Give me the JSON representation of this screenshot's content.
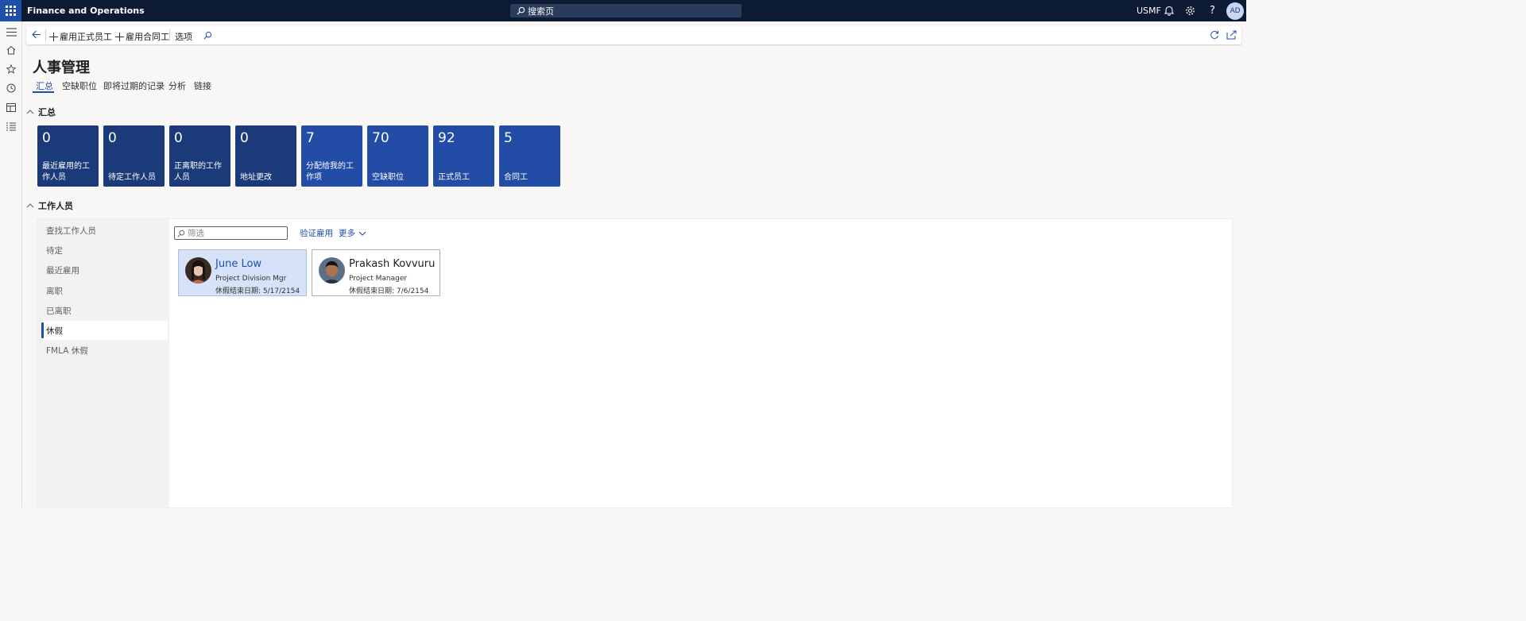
{
  "app": {
    "title": "Finance and Operations",
    "search_placeholder": "搜索页",
    "company": "USMF",
    "user_initials": "AD"
  },
  "action_pane": {
    "hire_employee": "雇用正式员工",
    "hire_contractor": "雇用合同工",
    "options": "选项"
  },
  "page": {
    "title": "人事管理",
    "tabs": [
      {
        "label": "汇总"
      },
      {
        "label": "空缺职位"
      },
      {
        "label": "即将过期的记录"
      },
      {
        "label": "分析"
      },
      {
        "label": "链接"
      }
    ]
  },
  "summary": {
    "header": "汇总",
    "tiles": [
      {
        "count": "0",
        "label": "最近雇用的工作人员"
      },
      {
        "count": "0",
        "label": "待定工作人员"
      },
      {
        "count": "0",
        "label": "正离职的工作人员"
      },
      {
        "count": "0",
        "label": "地址更改"
      },
      {
        "count": "7",
        "label": "分配给我的工作项"
      },
      {
        "count": "70",
        "label": "空缺职位"
      },
      {
        "count": "92",
        "label": "正式员工"
      },
      {
        "count": "5",
        "label": "合同工"
      }
    ]
  },
  "workers": {
    "header": "工作人员",
    "nav": [
      {
        "label": "查找工作人员"
      },
      {
        "label": "待定"
      },
      {
        "label": "最近雇用"
      },
      {
        "label": "离职"
      },
      {
        "label": "已离职"
      },
      {
        "label": "休假"
      },
      {
        "label": "FMLA 休假"
      }
    ],
    "filter_placeholder": "筛选",
    "verify_employment": "验证雇用",
    "more": "更多",
    "cards": [
      {
        "name": "June Low",
        "role": "Project Division Mgr",
        "leave": "休假结束日期: 5/17/2154"
      },
      {
        "name": "Prakash Kovvuru",
        "role": "Project Manager",
        "leave": "休假结束日期: 7/6/2154"
      }
    ]
  },
  "colors": {
    "nav_bar": "#0d1a33",
    "accent": "#1f4fa8",
    "tile_dark": "#1b3a7a",
    "tile_light": "#234ca6"
  },
  "icons": [
    "waffle-icon",
    "search-icon",
    "bell-icon",
    "settings-icon",
    "help-icon",
    "hamburger-icon",
    "home-icon",
    "star-icon",
    "clock-icon",
    "workspace-icon",
    "list-icon",
    "back-arrow-icon",
    "plus-icon",
    "refresh-icon",
    "open-new-icon",
    "chevron-up-icon",
    "chevron-down-icon"
  ]
}
